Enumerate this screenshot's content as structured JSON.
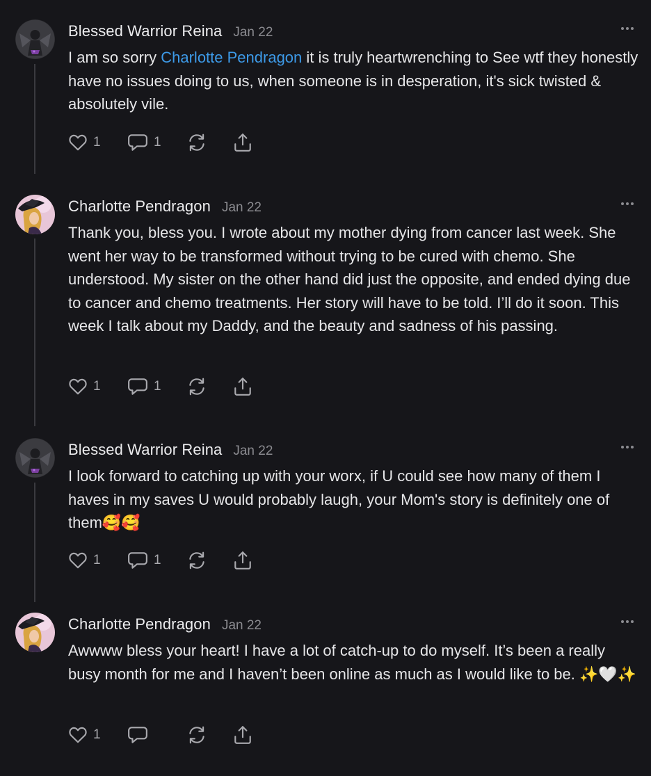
{
  "comments": [
    {
      "author": "Blessed Warrior Reina",
      "date": "Jan 22",
      "text_before": "I am so sorry ",
      "mention": "Charlotte Pendragon",
      "text_after": " it is truly heartwrenching to See wtf they honestly have no issues doing to us, when someone is in desperation, it's sick twisted & absolutely vile.",
      "likes": "1",
      "replies": "1"
    },
    {
      "author": "Charlotte Pendragon",
      "date": "Jan 22",
      "text": "Thank you, bless you. I wrote about my mother dying from cancer last week. She went her way to be transformed without trying to be cured with chemo. She understood. My sister on the other hand did just the opposite, and ended dying due to cancer and chemo treatments. Her story will have to be told. I’ll do it soon. This week I talk about my Daddy, and the beauty and sadness of his passing.",
      "likes": "1",
      "replies": "1"
    },
    {
      "author": "Blessed Warrior Reina",
      "date": "Jan 22",
      "text": "I look forward to catching up with your worx, if U could see how many of them I haves in my saves U would probably laugh, your Mom's story is definitely one of them🥰🥰",
      "likes": "1",
      "replies": "1"
    },
    {
      "author": "Charlotte Pendragon",
      "date": "Jan 22",
      "text": "Awwww bless your heart! I have a lot of catch-up to do myself. It’s been a really busy month for me and I haven’t been online as much as I would like to be. ✨🤍✨",
      "likes": "1",
      "replies": ""
    }
  ],
  "icons": [
    "heart-icon",
    "comment-icon",
    "restack-icon",
    "share-icon",
    "more-icon"
  ],
  "colors": {
    "background": "#16161a",
    "mention": "#3d9ae8",
    "muted": "#8b8b90",
    "thread_line": "#3a3a3f"
  }
}
